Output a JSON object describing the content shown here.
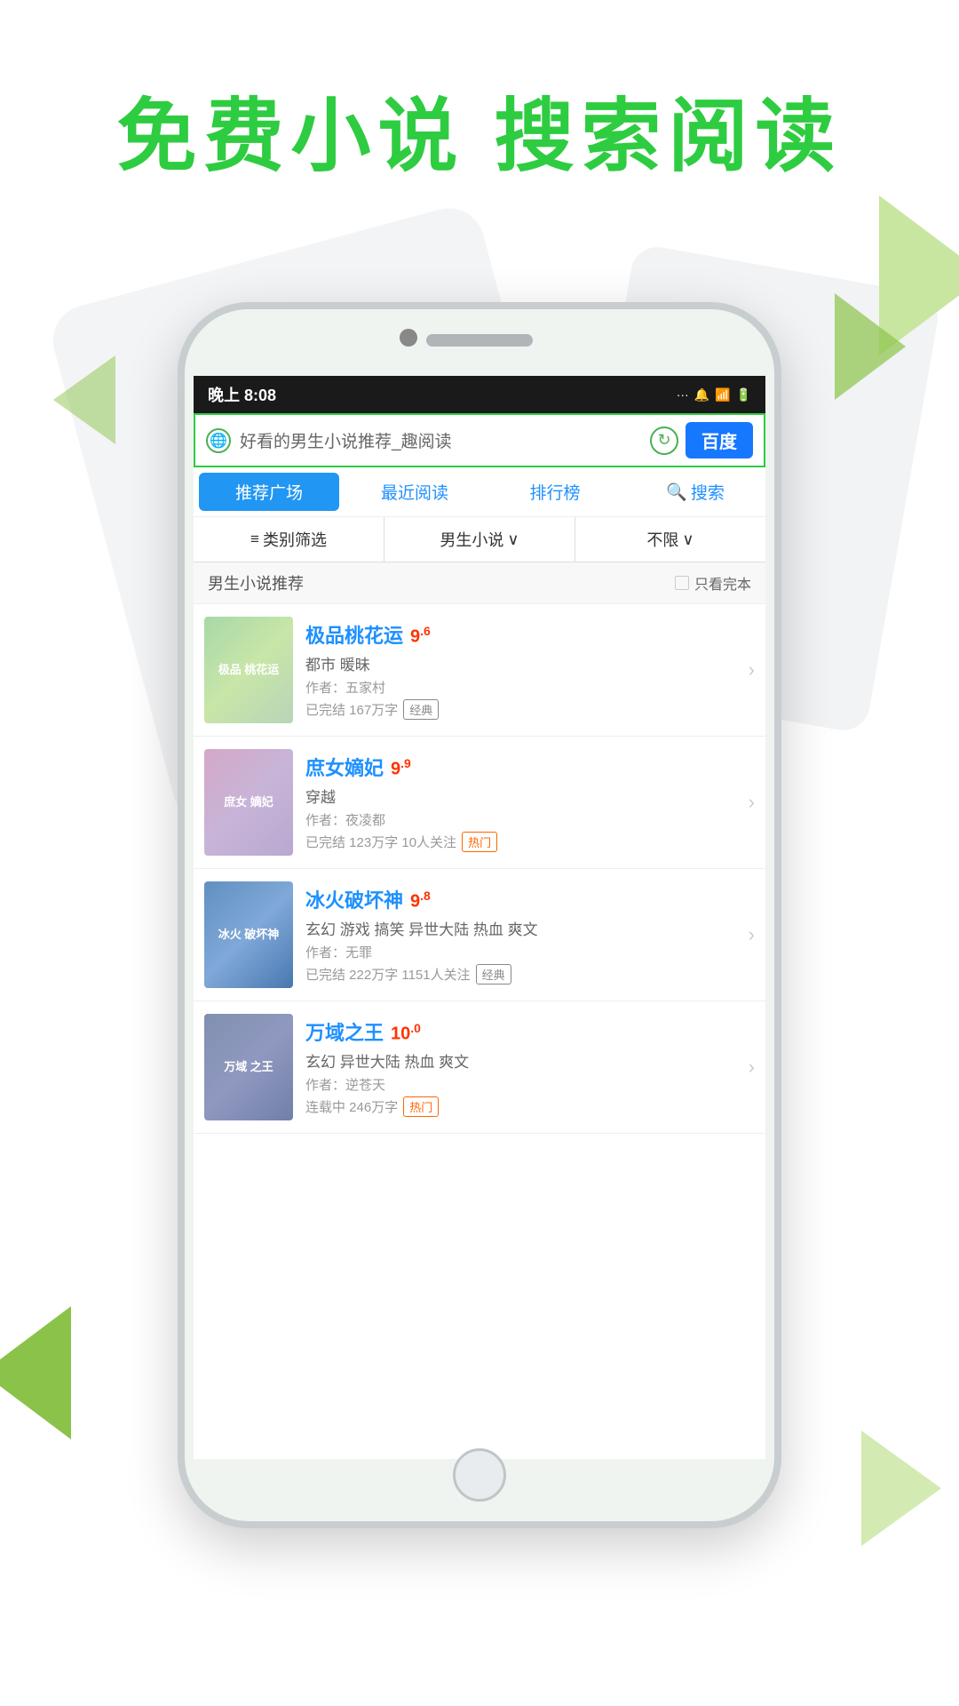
{
  "page": {
    "background_color": "#ffffff"
  },
  "header": {
    "title": "免费小说  搜索阅读"
  },
  "phone": {
    "status_bar": {
      "time": "晚上 8:08",
      "icons": "... 🔔 ⊛ ⚡"
    },
    "search": {
      "placeholder": "好看的男生小说推荐_趣阅读",
      "baidu_label": "百度"
    },
    "nav_tabs": [
      {
        "label": "推荐广场",
        "active": true
      },
      {
        "label": "最近阅读",
        "active": false
      },
      {
        "label": "排行榜",
        "active": false
      },
      {
        "label": "搜索",
        "active": false,
        "has_icon": true
      }
    ],
    "filter": {
      "category_label": "类别筛选",
      "genre_label": "男生小说",
      "genre_suffix": "∨",
      "limit_label": "不限",
      "limit_suffix": "∨"
    },
    "section": {
      "title": "男生小说推荐",
      "only_complete_label": "只看完本"
    },
    "books": [
      {
        "title": "极品桃花运",
        "rating": "9",
        "rating_decimal": "6",
        "genre": "都市 暖昧",
        "author": "作者：五家村",
        "meta": "已完结 167万字",
        "tag": "经典",
        "tag_type": "classic",
        "cover_class": "cover-1",
        "cover_text": "极品\n桃花运"
      },
      {
        "title": "庶女嫡妃",
        "rating": "9",
        "rating_decimal": "9",
        "genre": "穿越",
        "author": "作者：夜凌都",
        "meta": "已完结 123万字 10人关注",
        "tag": "热门",
        "tag_type": "hot",
        "cover_class": "cover-2",
        "cover_text": "庶女\n嫡妃"
      },
      {
        "title": "冰火破坏神",
        "rating": "9",
        "rating_decimal": "8",
        "genre": "玄幻 游戏 搞笑 异世大陆 热血 爽文",
        "author": "作者：无罪",
        "meta": "已完结 222万字 1151人关注",
        "tag": "经典",
        "tag_type": "classic",
        "cover_class": "cover-3",
        "cover_text": "冰火\n破坏神"
      },
      {
        "title": "万域之王",
        "rating": "10",
        "rating_decimal": "0",
        "genre": "玄幻 异世大陆 热血 爽文",
        "author": "作者：逆苍天",
        "meta": "连载中 246万字",
        "tag": "热门",
        "tag_type": "hot",
        "cover_class": "cover-4",
        "cover_text": "万域\n之王"
      }
    ]
  }
}
